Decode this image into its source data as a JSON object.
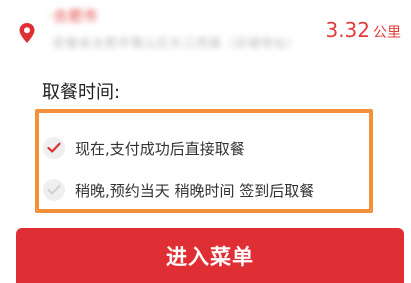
{
  "colors": {
    "accent": "#e02f34",
    "highlight": "#f2913a"
  },
  "store": {
    "name": "·合肥市",
    "address": "·安徽省合肥市蜀山区长江西路（店铺地址）",
    "distance_value": "3.32",
    "distance_unit": "公里"
  },
  "pickup": {
    "title": "取餐时间:",
    "options": [
      {
        "label": "现在,支付成功后直接取餐",
        "checked": true
      },
      {
        "label": "稍晚,预约当天 稍晚时间 签到后取餐",
        "checked": false
      }
    ]
  },
  "actions": {
    "enter_menu_label": "进入菜单"
  }
}
